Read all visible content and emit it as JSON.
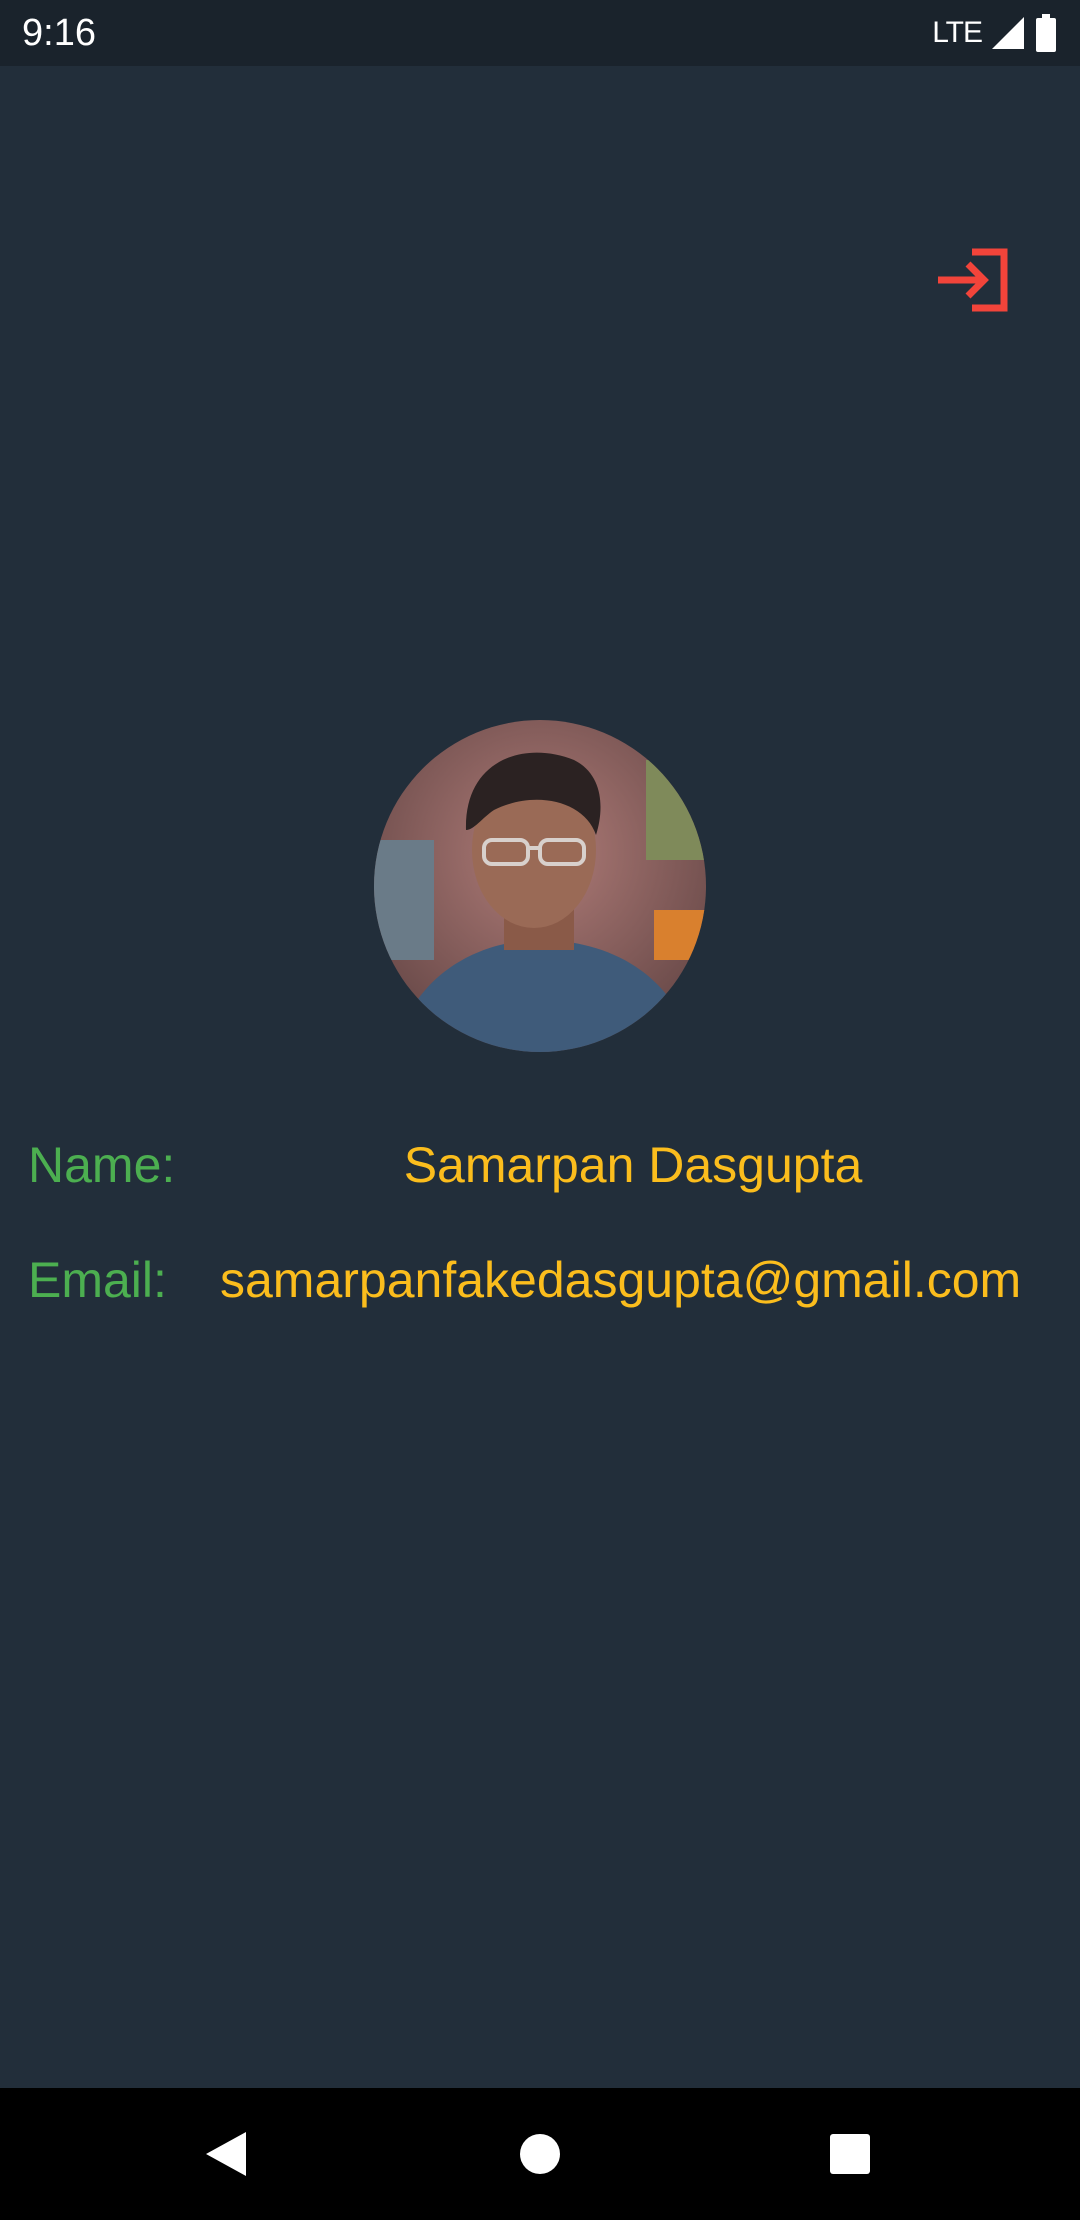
{
  "status_bar": {
    "time": "9:16",
    "network": "LTE",
    "icons": [
      "signal-icon",
      "battery-icon"
    ]
  },
  "toolbar": {
    "logout_icon": "logout-icon",
    "accent_color": "#f2443a"
  },
  "profile": {
    "avatar": "profile-photo",
    "name_label": "Name:",
    "name_value": "Samarpan Dasgupta",
    "email_label": "Email:",
    "email_value": "samarpanfakedasgupta@gmail.com"
  },
  "colors": {
    "background": "#222e3a",
    "label": "#4caf50",
    "value": "#fbbd1d"
  },
  "nav_bar": {
    "icons": [
      "back-icon",
      "home-icon",
      "recents-icon"
    ]
  }
}
